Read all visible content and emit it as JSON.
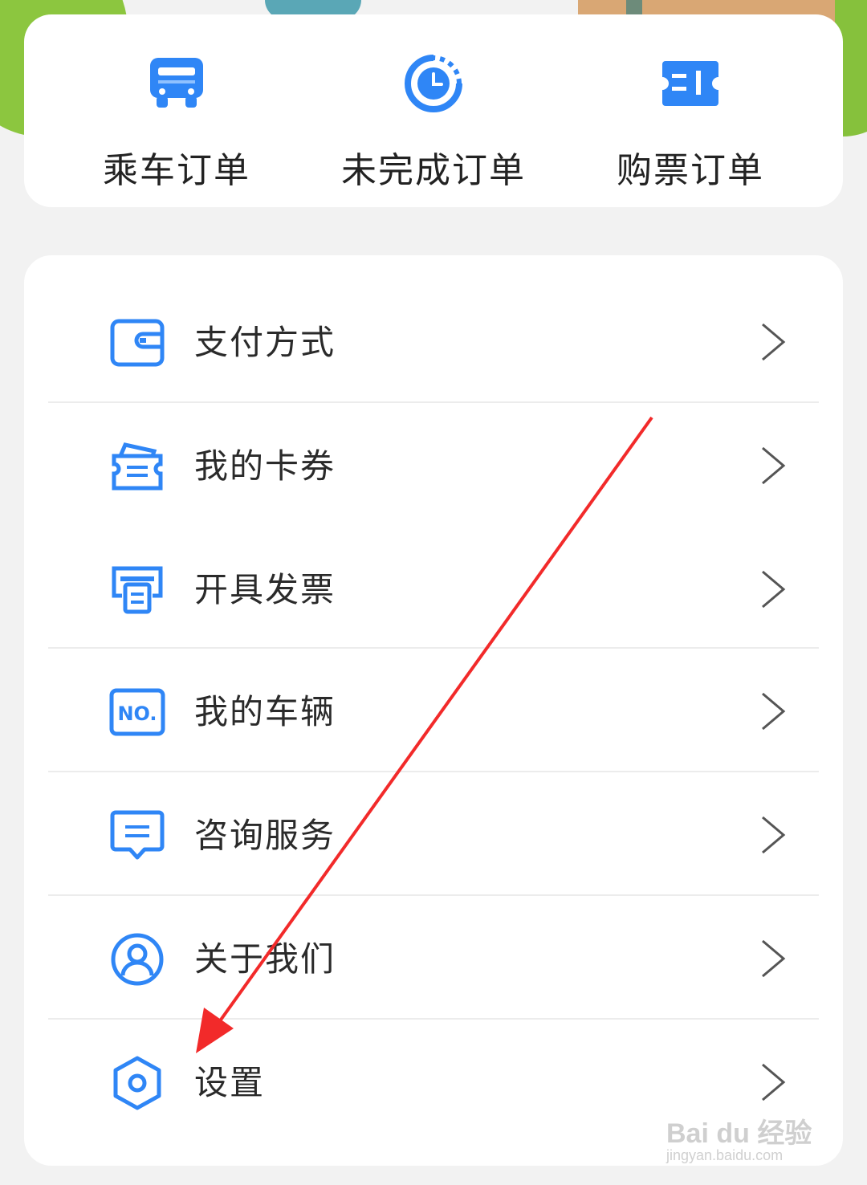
{
  "orders": [
    {
      "label": "乘车订单",
      "icon": "bus-icon"
    },
    {
      "label": "未完成订单",
      "icon": "clock-icon"
    },
    {
      "label": "购票订单",
      "icon": "ticket-icon"
    }
  ],
  "menu": [
    {
      "label": "支付方式",
      "icon": "wallet-icon"
    },
    {
      "label": "我的卡券",
      "icon": "coupon-icon"
    },
    {
      "label": "开具发票",
      "icon": "invoice-printer-icon"
    },
    {
      "label": "我的车辆",
      "icon": "license-plate-icon",
      "icon_text": "NO."
    },
    {
      "label": "咨询服务",
      "icon": "chat-icon"
    },
    {
      "label": "关于我们",
      "icon": "user-circle-icon"
    },
    {
      "label": "设置",
      "icon": "settings-hexagon-icon"
    }
  ],
  "watermark": {
    "brand": "Bai du 经验",
    "url": "jingyan.baidu.com"
  },
  "colors": {
    "accent": "#2f86f6",
    "annotation_arrow": "#f22a2a"
  }
}
